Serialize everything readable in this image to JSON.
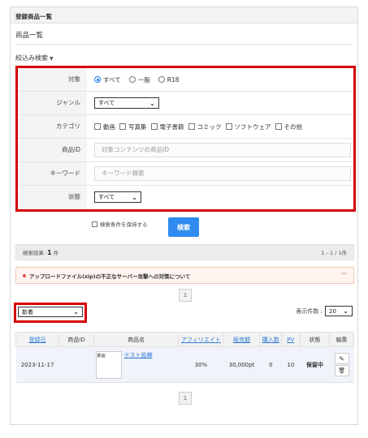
{
  "panel": {
    "header": "登録商品一覧"
  },
  "page": {
    "title": "商品一覧",
    "filter_toggle": "絞込み検索"
  },
  "filters": {
    "target": {
      "label": "対象",
      "options": [
        "すべて",
        "一般",
        "R18"
      ],
      "selected": "すべて"
    },
    "genre": {
      "label": "ジャンル",
      "value": "すべて"
    },
    "category": {
      "label": "カテゴリ",
      "options": [
        "動画",
        "写真集",
        "電子書籍",
        "コミック",
        "ソフトウェア",
        "その他"
      ]
    },
    "product_id": {
      "label": "商品ID",
      "placeholder": "対象コンテンツの商品ID"
    },
    "keyword": {
      "label": "キーワード",
      "placeholder": "キーワード検索"
    },
    "status": {
      "label": "状態",
      "value": "すべて"
    }
  },
  "keep_conditions": "検索条件を保持する",
  "search_button": "検索",
  "result": {
    "prefix": "検索結果 :",
    "count": "1",
    "suffix": "件",
    "range": "1 - 1 / 1件"
  },
  "notice": "アップロードファイル(zip)の不正なサーバー攻撃への対策について",
  "pager": {
    "page": "1"
  },
  "sort": {
    "value": "新着"
  },
  "per_page": {
    "label": "表示件数 :",
    "value": "20"
  },
  "table": {
    "headers": [
      "登録日",
      "商品ID",
      "商品名",
      "アフィリエイト",
      "販売額",
      "購入数",
      "PV",
      "状態",
      "編集"
    ],
    "rows": [
      {
        "date": "2023-11-17",
        "product_id": "",
        "thumb_tag": "動画",
        "name": "テスト投稿",
        "affiliate": "30%",
        "price": "30,000pt",
        "purchases": "0",
        "pv": "10",
        "status": "保留中"
      }
    ]
  }
}
